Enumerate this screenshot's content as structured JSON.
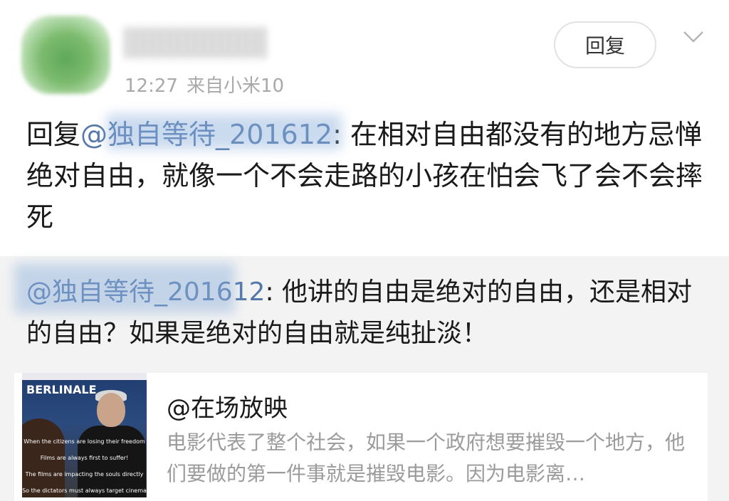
{
  "comment": {
    "time": "12:27",
    "source": "来自小米10",
    "reply_button": "回复",
    "text_prefix": "回复",
    "mention": "@独自等待_201612",
    "text_body": ": 在相对自由都没有的地方忌惮绝对自由，就像一个不会走路的小孩在怕会飞了会不会摔死"
  },
  "quoted": {
    "mention": "@独自等待_201612",
    "text_body": ": 他讲的自由是绝对的自由，还是相对的自由？如果是绝对的自由就是纯扯淡！"
  },
  "card": {
    "title": "@在场放映",
    "description": "电影代表了整个社会，如果一个政府想要摧毁一个地方，他们要做的第一件事就是摧毁电影。因为电影离…",
    "thumbnail_banner": "BERLINALE",
    "subtitles": [
      "When the citizens are losing their freedom",
      "Films are always first to suffer!",
      "The films are impacting the souls directly",
      "So the dictators must always target cinema"
    ]
  },
  "icons": {
    "chevron": "chevron-down-icon"
  }
}
